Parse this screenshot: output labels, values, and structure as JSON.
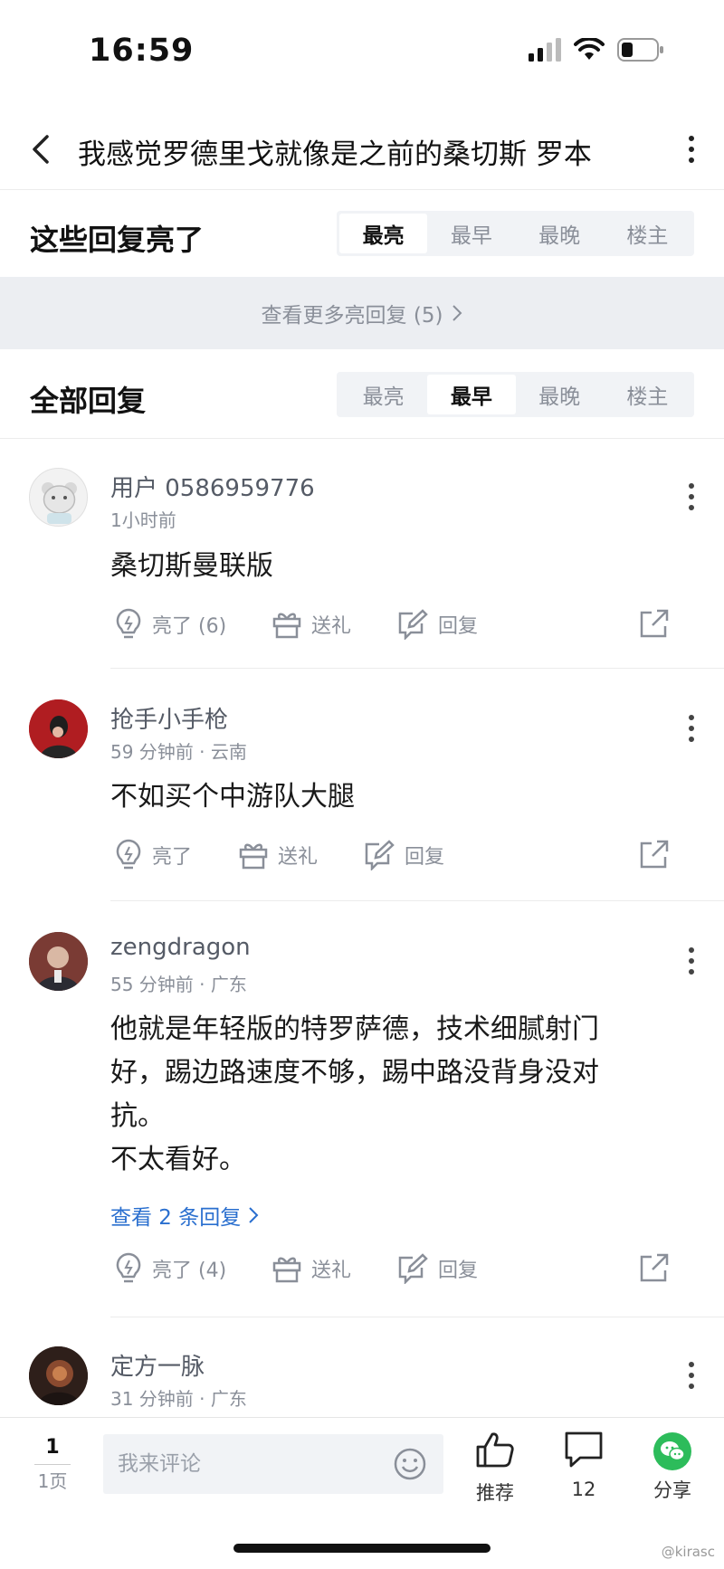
{
  "status": {
    "time": "16:59"
  },
  "nav": {
    "title": "我感觉罗德里戈就像是之前的桑切斯 罗本"
  },
  "hot_section": {
    "title": "这些回复亮了",
    "tabs": [
      "最亮",
      "最早",
      "最晚",
      "楼主"
    ],
    "active": "最亮",
    "more_label": "查看更多亮回复 (5)"
  },
  "all_section": {
    "title": "全部回复",
    "tabs": [
      "最亮",
      "最早",
      "最晚",
      "楼主"
    ],
    "active": "最早"
  },
  "comments": [
    {
      "user": "用户 0586959776",
      "meta": "1小时前",
      "text": "桑切斯曼联版",
      "like_label": "亮了 (6)",
      "gift_label": "送礼",
      "reply_label": "回复"
    },
    {
      "user": "抢手小手枪",
      "meta": "59 分钟前 · 云南",
      "text": "不如买个中游队大腿",
      "like_label": "亮了",
      "gift_label": "送礼",
      "reply_label": "回复"
    },
    {
      "user": "zengdragon",
      "meta": "55 分钟前 · 广东",
      "text_lines": [
        "他就是年轻版的特罗萨德，技术细腻射门",
        "好，踢边路速度不够，踢中路没背身没对",
        "抗。",
        "不太看好。"
      ],
      "replies_link": "查看 2 条回复",
      "like_label": "亮了 (4)",
      "gift_label": "送礼",
      "reply_label": "回复"
    },
    {
      "user": "定方一脉",
      "meta": "31 分钟前 · 广东"
    }
  ],
  "bottom_bar": {
    "page_current": "1",
    "page_label": "1页",
    "input_placeholder": "我来评论",
    "recommend_label": "推荐",
    "comment_count": "12",
    "share_label": "分享"
  },
  "watermark": "@kirasc",
  "colors": {
    "link": "#2a6fcf",
    "muted": "#8a8f99",
    "wechat": "#2dbc5b"
  }
}
